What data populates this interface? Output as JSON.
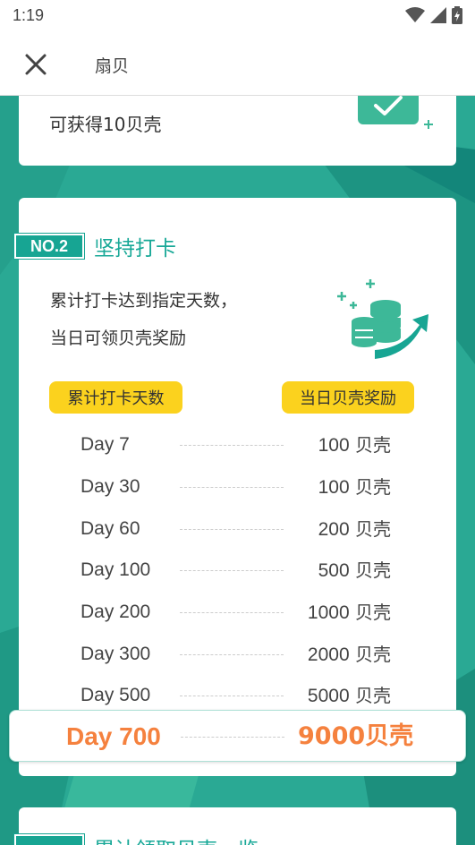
{
  "status_bar": {
    "time": "1:19",
    "icons": [
      "wifi-icon",
      "signal-icon",
      "battery-icon"
    ]
  },
  "app_bar": {
    "close_icon": "close-icon",
    "title": "扇贝"
  },
  "top_card": {
    "text": "可获得10贝壳",
    "icon": "check-icon"
  },
  "main_card": {
    "badge": "NO.2",
    "title": "坚持打卡",
    "description_line1": "累计打卡达到指定天数，",
    "description_line2": "当日可领贝壳奖励",
    "illustration": "coins-growth-icon",
    "header_left": "累计打卡天数",
    "header_right": "当日贝壳奖励",
    "rows": [
      {
        "day": "Day 7",
        "amount": "100",
        "unit": "贝壳"
      },
      {
        "day": "Day 30",
        "amount": "100",
        "unit": "贝壳"
      },
      {
        "day": "Day 60",
        "amount": "200",
        "unit": "贝壳"
      },
      {
        "day": "Day 100",
        "amount": "500",
        "unit": "贝壳"
      },
      {
        "day": "Day 200",
        "amount": "1000",
        "unit": "贝壳"
      },
      {
        "day": "Day 300",
        "amount": "2000",
        "unit": "贝壳"
      },
      {
        "day": "Day 500",
        "amount": "5000",
        "unit": "贝壳"
      }
    ],
    "highlight": {
      "day": "Day 700",
      "reward": "9000贝壳"
    }
  },
  "bottom_card": {
    "title": "累计领取贝壳一览"
  },
  "colors": {
    "teal": "#17a593",
    "yellow": "#fbd21e",
    "orange": "#f5813e",
    "background": "#2aa994"
  }
}
